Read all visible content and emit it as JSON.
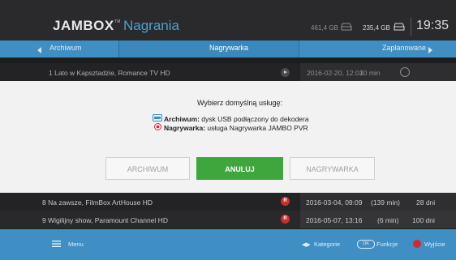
{
  "header": {
    "logo": "JAMBOX",
    "logo_mark": "TM",
    "title": "Nagrania",
    "storage_1": "461,4 GB",
    "storage_2": "235,4 GB",
    "clock": "19:35"
  },
  "tabs": {
    "left": "Archiwum",
    "center": "Nagrywarka",
    "right": "Zaplanowane"
  },
  "rows": [
    {
      "title": "1 Lato w Kapsztadzie, Romance TV HD",
      "date": "2016-02-20, 12:01",
      "duration": "30 min",
      "days": ""
    },
    {
      "title": "8 Na zawsze, FilmBox ArtHouse HD",
      "date": "2016-03-04, 09:09",
      "duration": "(139 min)",
      "days": "28 dni",
      "badge": "R"
    },
    {
      "title": "9 Wigilijny show, Paramount Channel HD",
      "date": "2016-05-07, 13:16",
      "duration": "(6 min)",
      "days": "100 dni",
      "badge": "R"
    }
  ],
  "dialog": {
    "title": "Wybierz domyślną usługę:",
    "line1_bold": "Archiwum:",
    "line1_text": " dysk USB podłączony do dekodera",
    "line2_bold": "Nagrywarka:",
    "line2_text": " usługa Nagrywarka JAMBO PVR",
    "btn_archive": "ARCHIWUM",
    "btn_cancel": "ANULUJ",
    "btn_recorder": "NAGRYWARKA"
  },
  "footer": {
    "menu": "Menu",
    "categories": "Kategorie",
    "ok": "OK",
    "functions": "Funkcje",
    "exit": "Wyjście"
  },
  "colors": {
    "accent_blue": "#3f8ec4",
    "green_button": "#3ea63c",
    "record_red": "#c9302c"
  },
  "icons": [
    "hdd-icon",
    "play-icon",
    "clock-icon",
    "record-badge-icon",
    "archive-icon",
    "recorder-icon",
    "menu-icon",
    "arrows-icon",
    "red-button-icon"
  ]
}
